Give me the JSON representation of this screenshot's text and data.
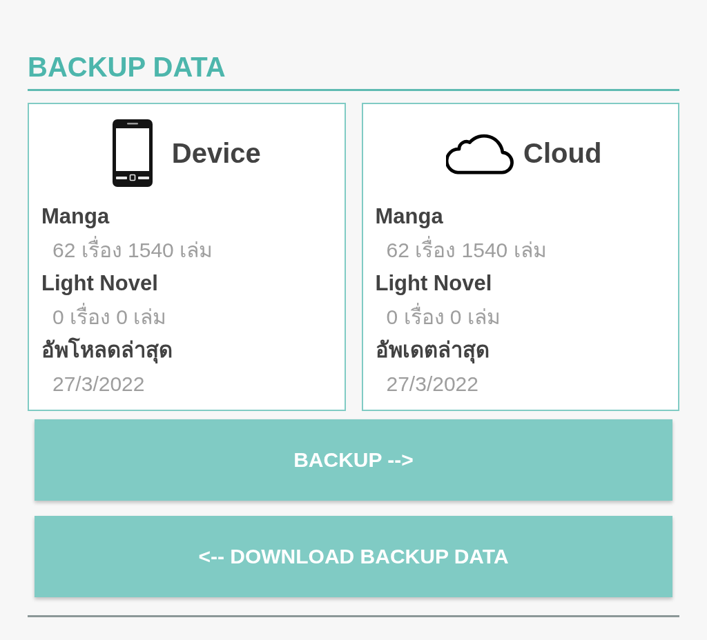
{
  "title": "BACKUP DATA",
  "panels": [
    {
      "kind": "device",
      "name": "Device",
      "stats": [
        {
          "label": "Manga",
          "value": "62 เรื่อง 1540 เล่ม"
        },
        {
          "label": "Light Novel",
          "value": "0 เรื่อง 0 เล่ม"
        },
        {
          "label": "อัพโหลดล่าสุด",
          "value": "27/3/2022"
        }
      ]
    },
    {
      "kind": "cloud",
      "name": "Cloud",
      "stats": [
        {
          "label": "Manga",
          "value": "62 เรื่อง 1540 เล่ม"
        },
        {
          "label": "Light Novel",
          "value": "0 เรื่อง 0 เล่ม"
        },
        {
          "label": "อัพเดตล่าสุด",
          "value": "27/3/2022"
        }
      ]
    }
  ],
  "buttons": [
    "BACKUP -->",
    "<-- DOWNLOAD BACKUP DATA"
  ]
}
